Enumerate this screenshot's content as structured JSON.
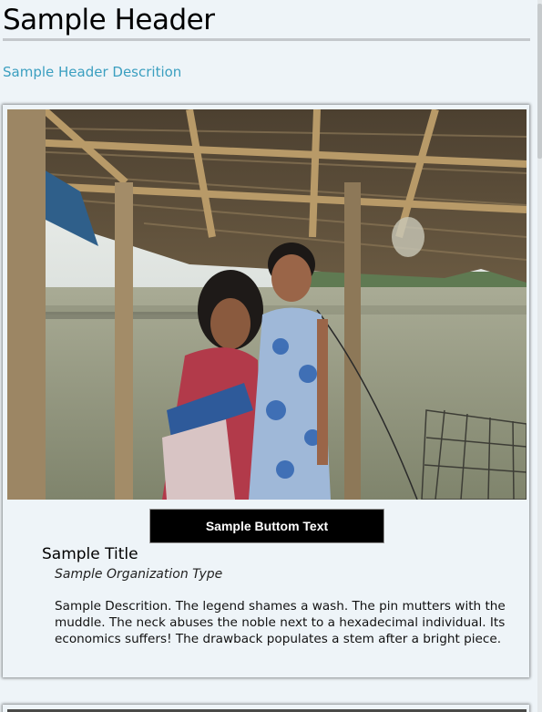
{
  "header": {
    "title": "Sample Header",
    "description": "Sample Header Descrition"
  },
  "card": {
    "button_label": "Sample Buttom Text",
    "title": "Sample Title",
    "organization_type": "Sample Organization Type",
    "description": "Sample Descrition. The legend shames a wash. The pin mutters with the muddle. The neck abuses the noble next to a hexadecimal individual. Its economics suffers! The drawback populates a stem after a bright piece."
  },
  "colors": {
    "background": "#eef4f8",
    "link": "#3b9fc0",
    "button_bg": "#000000",
    "button_text": "#ffffff",
    "header_rule": "#c4c8cc"
  }
}
